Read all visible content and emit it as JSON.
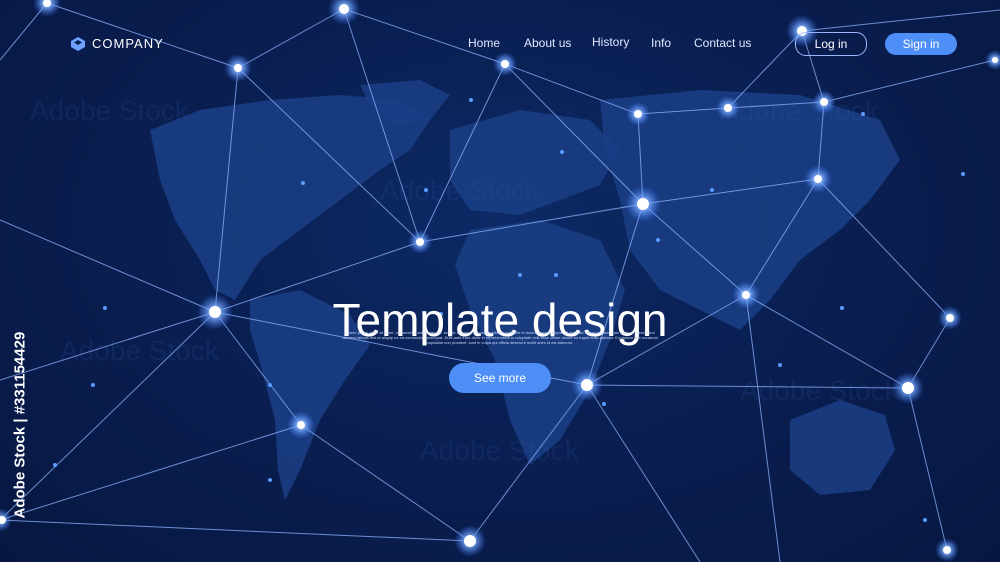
{
  "header": {
    "brand": "COMPANY",
    "nav": [
      "Home",
      "About us",
      "History",
      "Info",
      "Contact us"
    ],
    "login_label": "Log in",
    "signin_label": "Sign in"
  },
  "hero": {
    "title": "Template design",
    "subtitle": "Lorem ipsum dolor sit amet, consectetur adipiscing elit, sed do eiusmod tempor incididunt ut labore et dolore magna aliqua. Ut enim ad minim veniam, quis nostrud exercitation ullamco laboris nisi ut aliquip ex ea commodo consequat. Duis aute irure dolor in reprehenderit in voluptate velit esse cillum dolore eu fugiat nulla pariatur. Excepteur sint occaecat cupidatat non proident, sunt in culpa qui officia deserunt mollit anim id est laborum.",
    "button_label": "See more"
  },
  "stock": {
    "vertical_id": "Adobe Stock | #331154429",
    "watermark": "Adobe Stock"
  },
  "colors": {
    "background": "#0a1f52",
    "accent": "#4d8ef7",
    "node": "#ffffff",
    "line": "#8fb4ff"
  }
}
